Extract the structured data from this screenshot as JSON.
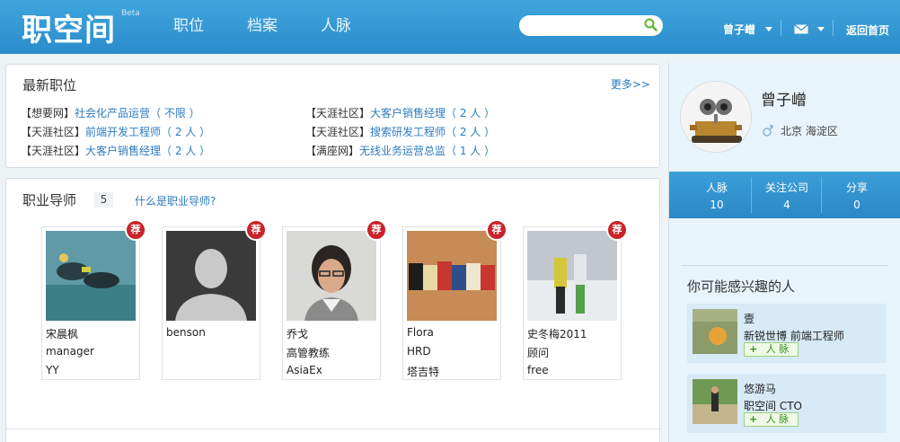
{
  "header": {
    "logo": "职空间",
    "beta": "Beta",
    "nav": [
      "职位",
      "档案",
      "人脉"
    ],
    "search_placeholder": "",
    "user": "曾子嶒",
    "home": "返回首页"
  },
  "jobs": {
    "title": "最新职位",
    "more": "更多>>",
    "items": [
      {
        "source": "【想要网】",
        "title": "社会化产品运营（ 不限 ）"
      },
      {
        "source": "【天涯社区】",
        "title": "大客户销售经理（ 2 人 ）"
      },
      {
        "source": "【天涯社区】",
        "title": "前端开发工程师（ 2 人 ）"
      },
      {
        "source": "【天涯社区】",
        "title": "搜索研发工程师（ 2 人 ）"
      },
      {
        "source": "【天涯社区】",
        "title": "大客户销售经理（ 2 人 ）"
      },
      {
        "source": "【满座网】",
        "title": "无线业务运营总监（ 1 人 ）"
      }
    ]
  },
  "mentors": {
    "title": "职业导师",
    "count": "5",
    "what": "什么是职业导师?",
    "badge": "荐",
    "cards": [
      {
        "name": "宋晨枫",
        "role": "manager",
        "org": "YY"
      },
      {
        "name": "benson",
        "role": "",
        "org": ""
      },
      {
        "name": "乔戈",
        "role": "高管教练",
        "org": "AsiaEx"
      },
      {
        "name": "Flora",
        "role": "HRD",
        "org": "塔吉特"
      },
      {
        "name": "史冬梅2011",
        "role": "顾问",
        "org": "free"
      }
    ]
  },
  "profile": {
    "name": "曾子嶒",
    "location": "北京 海淀区",
    "stats": [
      {
        "label": "人脉",
        "value": "10"
      },
      {
        "label": "关注公司",
        "value": "4"
      },
      {
        "label": "分享",
        "value": "0"
      }
    ]
  },
  "suggest": {
    "title": "你可能感兴趣的人",
    "add_label": "人 脉",
    "people": [
      {
        "name": "壹",
        "company": "新锐世博 前端工程师"
      },
      {
        "name": "悠游马",
        "company": "职空间 CTO"
      }
    ]
  }
}
